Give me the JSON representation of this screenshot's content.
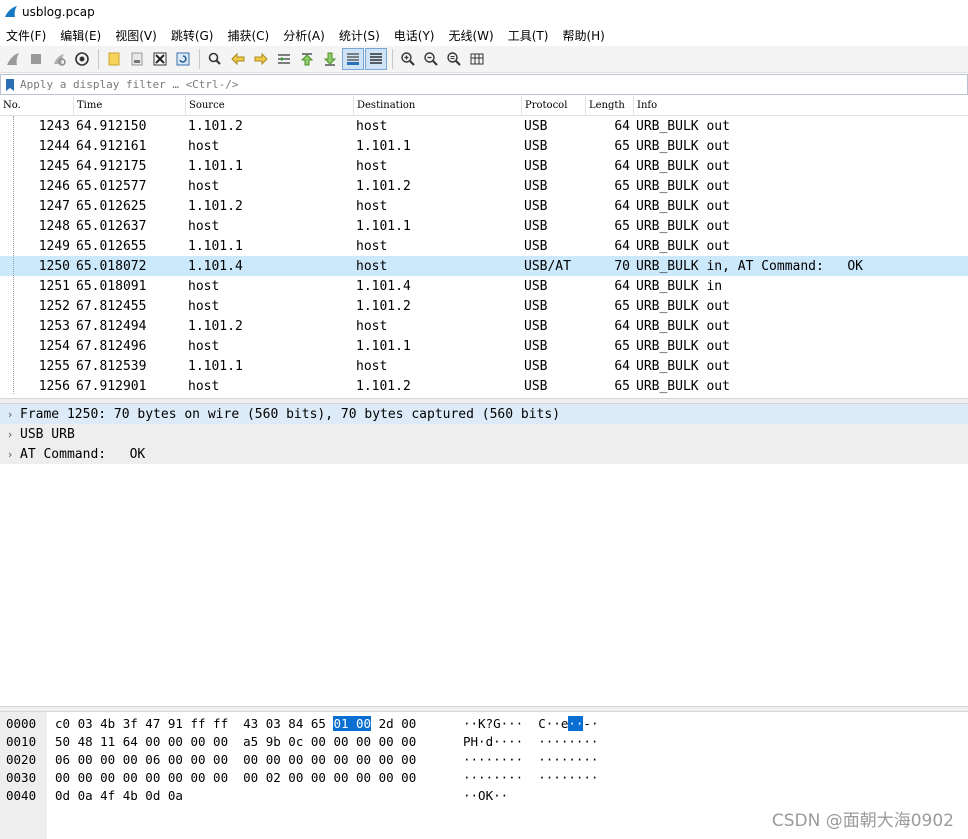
{
  "window": {
    "title": "usblog.pcap"
  },
  "menu": [
    "文件(F)",
    "编辑(E)",
    "视图(V)",
    "跳转(G)",
    "捕获(C)",
    "分析(A)",
    "统计(S)",
    "电话(Y)",
    "无线(W)",
    "工具(T)",
    "帮助(H)"
  ],
  "filter": {
    "placeholder": "Apply a display filter … <Ctrl-/>",
    "value": ""
  },
  "columns": [
    "No.",
    "Time",
    "Source",
    "Destination",
    "Protocol",
    "Length",
    "Info"
  ],
  "packets": [
    {
      "no": "1243",
      "time": "64.912150",
      "src": "1.101.2",
      "dst": "host",
      "proto": "USB",
      "len": "64",
      "info": "URB_BULK out"
    },
    {
      "no": "1244",
      "time": "64.912161",
      "src": "host",
      "dst": "1.101.1",
      "proto": "USB",
      "len": "65",
      "info": "URB_BULK out"
    },
    {
      "no": "1245",
      "time": "64.912175",
      "src": "1.101.1",
      "dst": "host",
      "proto": "USB",
      "len": "64",
      "info": "URB_BULK out"
    },
    {
      "no": "1246",
      "time": "65.012577",
      "src": "host",
      "dst": "1.101.2",
      "proto": "USB",
      "len": "65",
      "info": "URB_BULK out"
    },
    {
      "no": "1247",
      "time": "65.012625",
      "src": "1.101.2",
      "dst": "host",
      "proto": "USB",
      "len": "64",
      "info": "URB_BULK out"
    },
    {
      "no": "1248",
      "time": "65.012637",
      "src": "host",
      "dst": "1.101.1",
      "proto": "USB",
      "len": "65",
      "info": "URB_BULK out"
    },
    {
      "no": "1249",
      "time": "65.012655",
      "src": "1.101.1",
      "dst": "host",
      "proto": "USB",
      "len": "64",
      "info": "URB_BULK out"
    },
    {
      "no": "1250",
      "time": "65.018072",
      "src": "1.101.4",
      "dst": "host",
      "proto": "USB/AT",
      "len": "70",
      "info": "URB_BULK in, AT Command:   OK",
      "selected": true
    },
    {
      "no": "1251",
      "time": "65.018091",
      "src": "host",
      "dst": "1.101.4",
      "proto": "USB",
      "len": "64",
      "info": "URB_BULK in"
    },
    {
      "no": "1252",
      "time": "67.812455",
      "src": "host",
      "dst": "1.101.2",
      "proto": "USB",
      "len": "65",
      "info": "URB_BULK out"
    },
    {
      "no": "1253",
      "time": "67.812494",
      "src": "1.101.2",
      "dst": "host",
      "proto": "USB",
      "len": "64",
      "info": "URB_BULK out"
    },
    {
      "no": "1254",
      "time": "67.812496",
      "src": "host",
      "dst": "1.101.1",
      "proto": "USB",
      "len": "65",
      "info": "URB_BULK out"
    },
    {
      "no": "1255",
      "time": "67.812539",
      "src": "1.101.1",
      "dst": "host",
      "proto": "USB",
      "len": "64",
      "info": "URB_BULK out"
    },
    {
      "no": "1256",
      "time": "67.912901",
      "src": "host",
      "dst": "1.101.2",
      "proto": "USB",
      "len": "65",
      "info": "URB_BULK out"
    }
  ],
  "details": [
    {
      "text": "Frame 1250: 70 bytes on wire (560 bits), 70 bytes captured (560 bits)",
      "selected": true
    },
    {
      "text": "USB URB"
    },
    {
      "text": "AT Command:   OK"
    }
  ],
  "bytes": [
    {
      "off": "0000",
      "hex_a": "c0 03 4b 3f 47 91 ff ff  43 03 84 65 ",
      "hex_hl": "01 00",
      "hex_b": " 2d 00",
      "ascii_a": "··K?G···  C··e",
      "ascii_hl": "··",
      "ascii_b": "-·"
    },
    {
      "off": "0010",
      "hex_a": "50 48 11 64 00 00 00 00  a5 9b 0c 00 00 00 00 00",
      "hex_hl": "",
      "hex_b": "",
      "ascii_a": "PH·d····  ········",
      "ascii_hl": "",
      "ascii_b": ""
    },
    {
      "off": "0020",
      "hex_a": "06 00 00 00 06 00 00 00  00 00 00 00 00 00 00 00",
      "hex_hl": "",
      "hex_b": "",
      "ascii_a": "········  ········",
      "ascii_hl": "",
      "ascii_b": ""
    },
    {
      "off": "0030",
      "hex_a": "00 00 00 00 00 00 00 00  00 02 00 00 00 00 00 00",
      "hex_hl": "",
      "hex_b": "",
      "ascii_a": "········  ········",
      "ascii_hl": "",
      "ascii_b": ""
    },
    {
      "off": "0040",
      "hex_a": "0d 0a 4f 4b 0d 0a",
      "hex_hl": "",
      "hex_b": "",
      "ascii_a": "··OK··",
      "ascii_hl": "",
      "ascii_b": ""
    }
  ],
  "watermark": "CSDN @面朝大海0902",
  "colors": {
    "selected_row": "#cce8fb",
    "byte_highlight": "#0a6fd3",
    "accent": "#2a6fb5"
  }
}
